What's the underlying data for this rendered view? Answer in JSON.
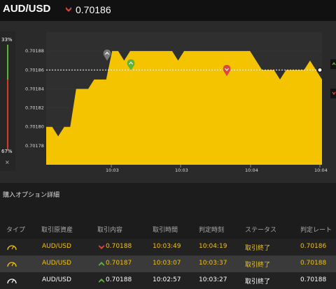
{
  "header": {
    "pair": "AUD/USD",
    "rate": "0.70186",
    "rate_direction": "down"
  },
  "gauge": {
    "top_pct": "33%",
    "bottom_pct": "67%",
    "close": "×"
  },
  "chart_data": {
    "type": "area",
    "y_ticks": [
      "0.70188",
      "0.70186",
      "0.70184",
      "0.70182",
      "0.70180",
      "0.70178"
    ],
    "x_ticks": [
      "10:03",
      "10:03",
      "10:04",
      "10:04"
    ],
    "current_rate": 0.70186,
    "fill_color": "#f5c400",
    "ylim": [
      0.70176,
      0.7019
    ],
    "series": [
      {
        "values": [
          0.7018,
          0.7018,
          0.70179,
          0.7018,
          0.7018,
          0.70184,
          0.70184,
          0.70184,
          0.70185,
          0.70185,
          0.70185,
          0.70188,
          0.70188,
          0.70187,
          0.70188,
          0.70188,
          0.70188,
          0.70188,
          0.70188,
          0.70188,
          0.70188,
          0.70188,
          0.70187,
          0.70188,
          0.70188,
          0.70188,
          0.70188,
          0.70188,
          0.70188,
          0.70188,
          0.70188,
          0.70188,
          0.70188,
          0.70188,
          0.70188,
          0.70187,
          0.70186,
          0.70186,
          0.70186,
          0.70185,
          0.70186,
          0.70186,
          0.70186,
          0.70186,
          0.70187,
          0.70186,
          0.70185
        ]
      }
    ]
  },
  "section_title": "購入オプション詳細",
  "table": {
    "headers": [
      "タイプ",
      "取引原資産",
      "取引内容",
      "取引時間",
      "判定時刻",
      "ステータス",
      "判定レート"
    ],
    "rows": [
      {
        "type_icon": "gauge-icon",
        "asset": "AUD/USD",
        "direction": "down",
        "rate": "0.70188",
        "time": "10:03:49",
        "judge_time": "10:04:19",
        "status": "取引終了",
        "judge_rate": "0.70186"
      },
      {
        "type_icon": "gauge-icon",
        "asset": "AUD/USD",
        "direction": "up",
        "rate": "0.70187",
        "time": "10:03:07",
        "judge_time": "10:03:37",
        "status": "取引終了",
        "judge_rate": "0.70188"
      },
      {
        "type_icon": "gauge-icon",
        "asset": "AUD/USD",
        "direction": "up",
        "rate": "0.70188",
        "time": "10:02:57",
        "judge_time": "10:03:27",
        "status": "取引終了",
        "judge_rate": "0.70188"
      }
    ]
  }
}
